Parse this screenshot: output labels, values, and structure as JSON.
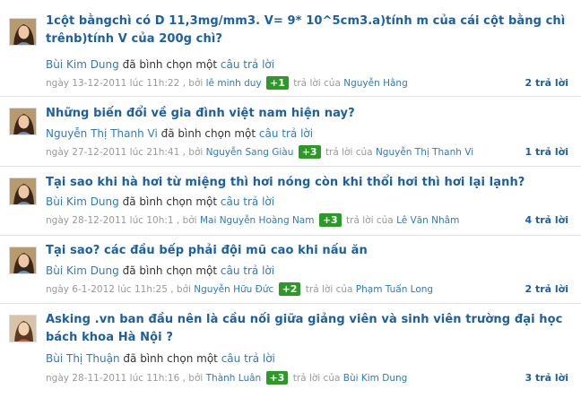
{
  "items": [
    {
      "title": "1cột bằngchì có D 11,3mg/mm3. V= 9* 10^5cm3.a)tính m của cái cột bằng chì trênb)tính V của 200g chì?",
      "activity_user": "Bùi Kim Dung",
      "activity_verb": "đã bình chọn một",
      "activity_link": "câu trả lời",
      "meta_prefix": "ngày 13-12-2011 lúc 11h:22 , bởi",
      "author": "lê minh duy",
      "votes": "+1",
      "meta_mid": "trả lời của",
      "answerer": "Nguyễn Hằng",
      "reply_count": "2 trả lời"
    },
    {
      "title": "Những biến đổi về gia đình việt nam hiện nay?",
      "activity_user": "Nguyễn Thị Thanh Vi",
      "activity_verb": "đã bình chọn một",
      "activity_link": "câu trả lời",
      "meta_prefix": "ngày 27-12-2011 lúc 21h:41 , bởi",
      "author": "Nguyễn Sang Giàu",
      "votes": "+3",
      "meta_mid": "trả lời của",
      "answerer": "Nguyễn Thị Thanh Vi",
      "reply_count": "1 trả lời"
    },
    {
      "title": "Tại sao khi hà hơi từ miệng thì hơi nóng còn khi thổi hơi thì hơi lại lạnh?",
      "activity_user": "Bùi Kim Dung",
      "activity_verb": "đã bình chọn một",
      "activity_link": "câu trả lời",
      "meta_prefix": "ngày 28-12-2011 lúc 10h:1 , bởi",
      "author": "Mai Nguyễn Hoàng Nam",
      "votes": "+3",
      "meta_mid": "trả lời của",
      "answerer": "Lê Văn Nhâm",
      "reply_count": "4 trả lời"
    },
    {
      "title": "Tại sao? các đầu bếp phải đội mũ cao khi nấu ăn",
      "activity_user": "Bùi Kim Dung",
      "activity_verb": "đã bình chọn một",
      "activity_link": "câu trả lời",
      "meta_prefix": "ngày 6-1-2012 lúc 11h:25 , bởi",
      "author": "Nguyễn Hữu Đức",
      "votes": "+2",
      "meta_mid": "trả lời của",
      "answerer": "Phạm Tuấn Long",
      "reply_count": "2 trả lời"
    },
    {
      "title": "Asking .vn ban đầu nên là cầu nối giữa giảng viên và sinh viên trường đại học bách khoa Hà Nội ?",
      "activity_user": "Bùi Thị Thuận",
      "activity_verb": "đã bình chọn một",
      "activity_link": "câu trả lời",
      "meta_prefix": "ngày 28-11-2011 lúc 11h:16 , bởi",
      "author": "Thành Luân",
      "votes": "+3",
      "meta_mid": "trả lời của",
      "answerer": "Bùi Kim Dung",
      "reply_count": "3 trả lời"
    }
  ]
}
